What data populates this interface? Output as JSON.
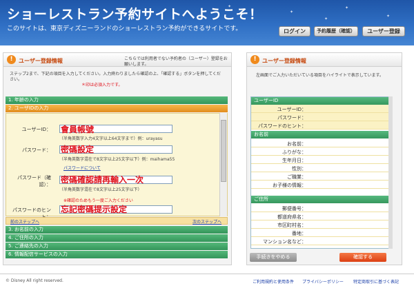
{
  "header": {
    "title": "ショーレストラン予約サイトへようこそ！",
    "subtitle": "このサイトは、東京ディズニーランドのショーレストラン予約ができるサイトです。",
    "buttons": [
      "ログイン",
      "予約履歴（確認）",
      "ユーザー登録"
    ]
  },
  "left_panel": {
    "title": "ユーザー登録情報",
    "intro": "こちらでは利用者でない予約者の（ユーザー）登録をお願いします。",
    "instruction": "ステップ2まで、下記の項目を入力してください。入力終わりましたら確認の上、「確認する」ボタンを押してください。",
    "required_note": "＊印は必須入力です。",
    "steps_top": [
      "1. 年齢の入力",
      "2. ユーザIDの入力"
    ],
    "form": {
      "user_id_label": "ユーザーID：",
      "user_id_value": "會員帳號",
      "user_id_hint": "（半角英数字入力4文字以上64文字まで）例：urayasu",
      "password_label": "パスワード：",
      "password_value": "密碼設定",
      "password_hint": "（半角英数字混在で8文字以上25文字以下）例：maihama55",
      "password_link": "パスワードについて",
      "confirm_label": "パスワード（確認）：",
      "confirm_value": "密碼確認請再輸入一次",
      "confirm_hint": "（半角英数字混在で8文字以上25文字以下）",
      "confirm_note": "※確認のためもう一度ご入力ください",
      "hint_label": "パスワードのヒント：",
      "hint_value": "忘記密碼提示設定"
    },
    "nav_prev": "前のステップへ",
    "nav_next": "次のステップへ",
    "steps_bottom": [
      "3. お名前の入力",
      "4. ご住所の入力",
      "5. ご連絡先の入力",
      "6. 情報配信サービスの入力"
    ]
  },
  "right_panel": {
    "title": "ユーザー登録情報",
    "desc": "左画面でご入力いただいている項目をハイライトで表示しています。",
    "sections": [
      {
        "name": "ユーザーID",
        "rows": [
          "ユーザーID：",
          "パスワード：",
          "パスワードのヒント："
        ]
      },
      {
        "name": "お名前",
        "rows": [
          "お名前：",
          "ふりがな：",
          "生年月日：",
          "性別：",
          "ご職業：",
          "お子様の情報："
        ]
      },
      {
        "name": "ご住所",
        "rows": [
          "郵便番号：",
          "都道府県名：",
          "市区町村名：",
          "番地：",
          "マンション名など："
        ]
      }
    ]
  },
  "actions": {
    "cancel": "手続きをやめる",
    "confirm": "確認する"
  },
  "footer": {
    "copyright": "© Disney All right reserved.",
    "links": [
      "ご利用規約と使用条件",
      "プライバシーポリシー",
      "特定商取引に基づく表記"
    ]
  }
}
